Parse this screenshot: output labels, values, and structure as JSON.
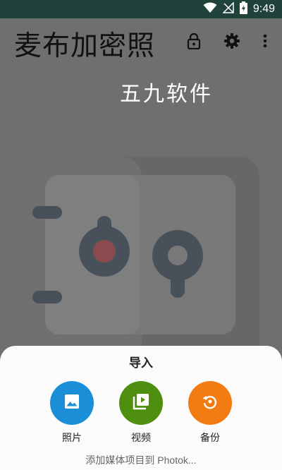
{
  "status_bar": {
    "time": "9:49",
    "icons": [
      "wifi-icon",
      "signal-off-icon",
      "battery-charging-icon"
    ]
  },
  "app_bar": {
    "title": "麦布加密照",
    "actions": [
      "lock-icon",
      "gear-icon",
      "more-vert-icon"
    ]
  },
  "watermark": "五九软件",
  "import_sheet": {
    "title": "导入",
    "options": [
      {
        "label": "照片",
        "icon": "image-icon",
        "color": "#1a8fd8"
      },
      {
        "label": "视频",
        "icon": "video-library-icon",
        "color": "#4f8f10"
      },
      {
        "label": "备份",
        "icon": "restore-icon",
        "color": "#f27c12"
      }
    ],
    "hint": "添加媒体项目到 Photok..."
  },
  "colors": {
    "status_bar_bg": "#1f433b",
    "scrim_bg": "#6f6f6f",
    "sheet_bg": "#fbfbfb"
  }
}
